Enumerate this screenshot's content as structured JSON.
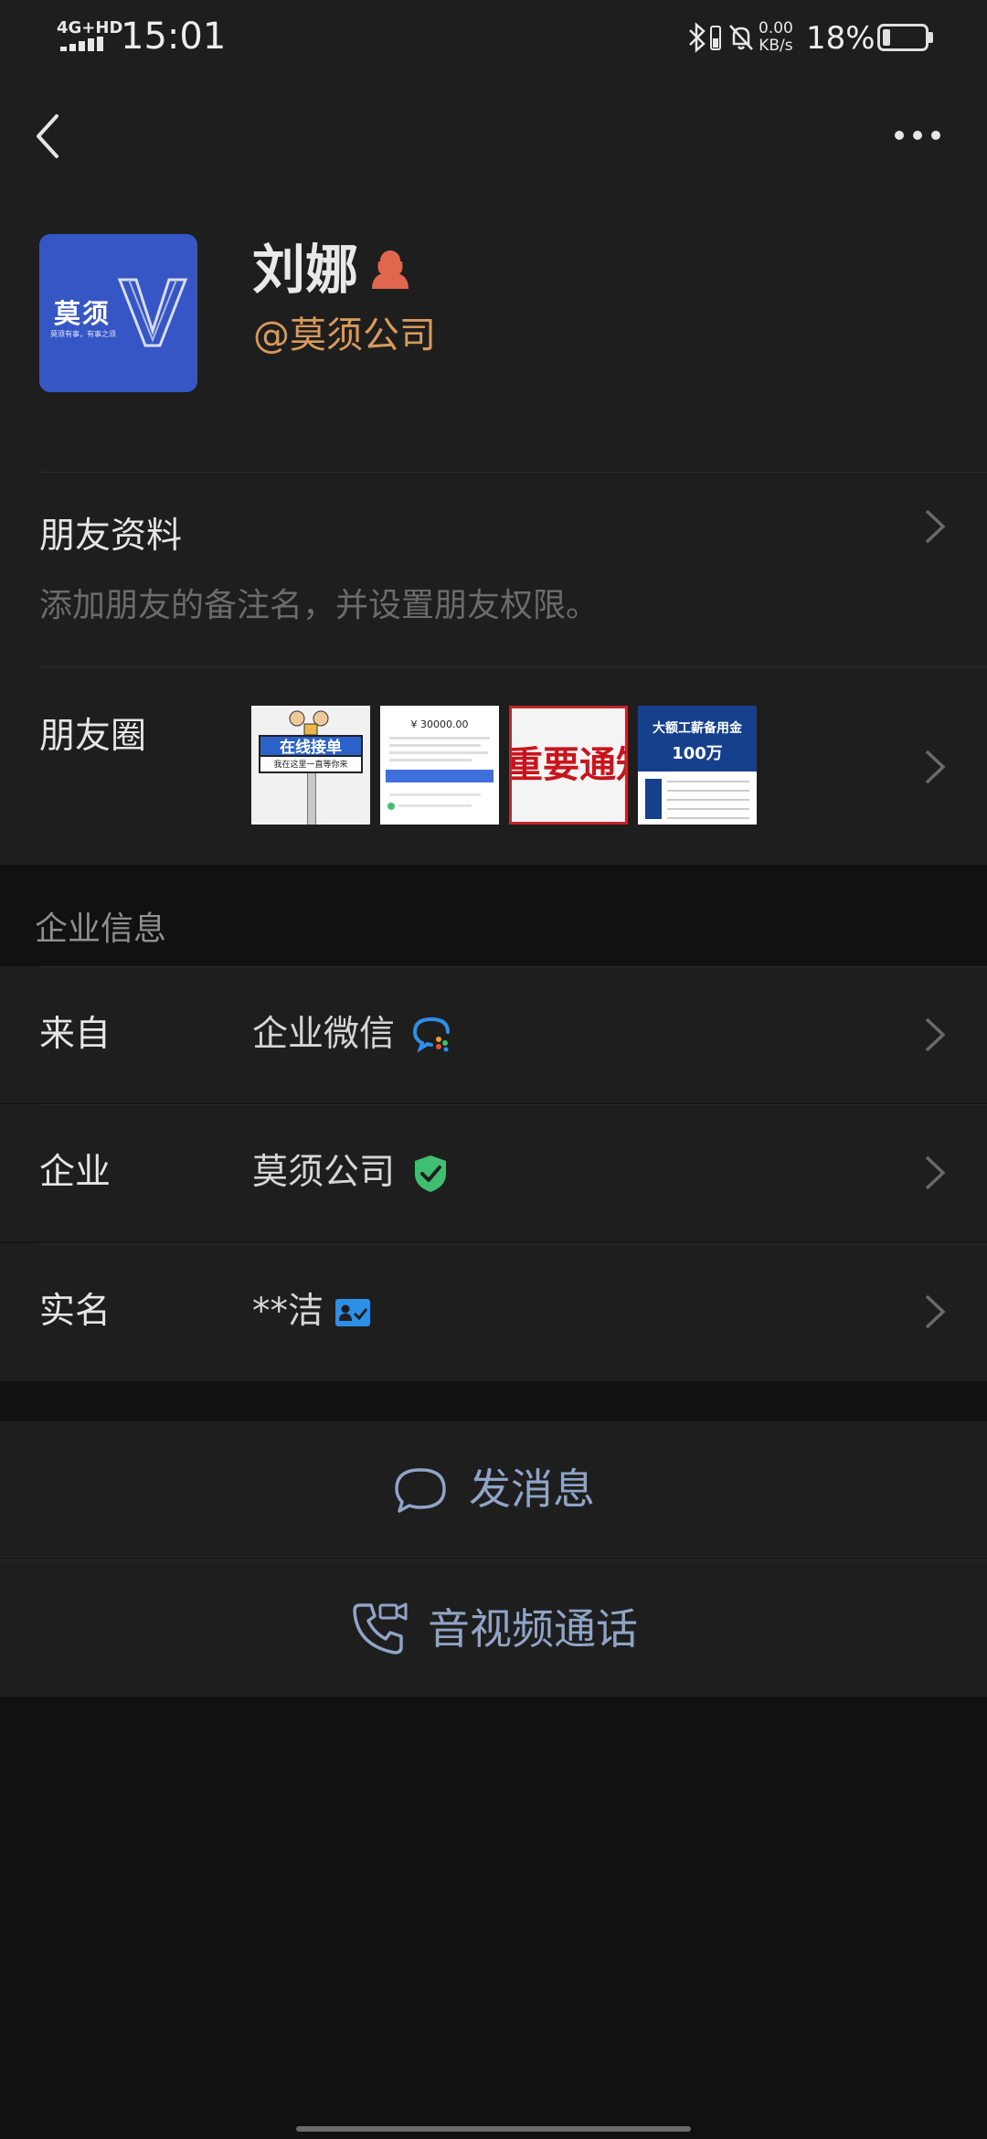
{
  "status_bar": {
    "network": "4G+HD",
    "time": "15:01",
    "speed_value": "0.00",
    "speed_unit": "KB/s",
    "battery_pct": "18%",
    "battery_level": 0.18
  },
  "nav": {
    "back_icon": "chevron-left-icon",
    "more_icon": "more-dots-icon"
  },
  "profile": {
    "avatar_text": "莫须",
    "avatar_sub": "莫须有事，有事之须",
    "name": "刘娜",
    "gender_icon": "female-user-icon",
    "company": "@莫须公司"
  },
  "friend_info": {
    "title": "朋友资料",
    "hint": "添加朋友的备注名，并设置朋友权限。"
  },
  "moments": {
    "title": "朋友圈",
    "thumbs": [
      {
        "banner": "在线接单",
        "caption": "我在这里一直等你来"
      },
      {
        "amount": "¥ 30000.00"
      },
      {
        "headline": "重要通知"
      },
      {
        "title": "大额工薪备用金",
        "amount": "100万"
      }
    ]
  },
  "enterprise": {
    "section_label": "企业信息",
    "rows": [
      {
        "label": "来自",
        "value": "企业微信",
        "icon": "wecom-logo-icon"
      },
      {
        "label": "企业",
        "value": "莫须公司",
        "icon": "verified-shield-icon"
      },
      {
        "label": "实名",
        "value": "**洁",
        "icon": "id-card-icon"
      }
    ]
  },
  "actions": {
    "message": "发消息",
    "call": "音视频通话"
  },
  "colors": {
    "background": "#111111",
    "card": "#1e1e1e",
    "accent_orange": "#d89a5a",
    "action_blue": "#8fa4c6",
    "verified_green": "#3fbf6f",
    "avatar_blue": "#3556c4"
  }
}
